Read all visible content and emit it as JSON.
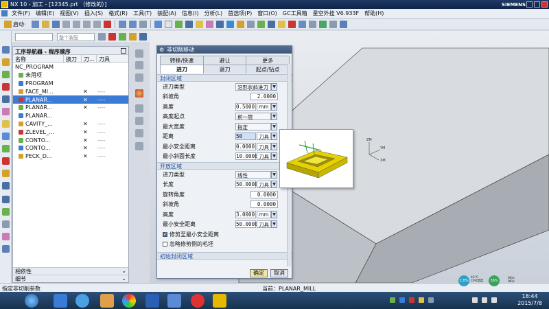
{
  "window": {
    "title": "NX 10 - 加工 - [12345.prt （修改的）]",
    "brand": "SIEMENS"
  },
  "menu": [
    "文件(F)",
    "编辑(E)",
    "视图(V)",
    "插入(S)",
    "格式(R)",
    "工具(T)",
    "装配(A)",
    "信息(I)",
    "分析(L)",
    "首选项(P)",
    "窗口(O)",
    "GC工具箱",
    "星空外挂 V6.933F",
    "帮助(H)"
  ],
  "toolbar": {
    "start_label": "启动·",
    "filter_placeholder": "整个装配"
  },
  "navigator": {
    "title": "工序导航器 - 程序顺序",
    "columns": [
      "名称",
      "换刀",
      "刀...",
      "刀具"
    ],
    "rows": [
      {
        "name": "NC_PROGRAM",
        "indent": 0,
        "x": "",
        "dash": ""
      },
      {
        "name": "未用项",
        "indent": 1,
        "x": "",
        "dash": ""
      },
      {
        "name": "PROGRAM",
        "indent": 1,
        "x": "",
        "dash": ""
      },
      {
        "name": "FACE_MI...",
        "indent": 2,
        "x": "✕",
        "dash": "----"
      },
      {
        "name": "PLANAR...",
        "indent": 2,
        "x": "✕",
        "dash": "----"
      },
      {
        "name": "PLANAR...",
        "indent": 2,
        "x": "✕",
        "dash": "----"
      },
      {
        "name": "PLANAR...",
        "indent": 2,
        "x": "",
        "dash": ""
      },
      {
        "name": "CAVITY_...",
        "indent": 2,
        "x": "✕",
        "dash": "----"
      },
      {
        "name": "ZLEVEL_...",
        "indent": 2,
        "x": "✕",
        "dash": "----"
      },
      {
        "name": "CONTO...",
        "indent": 2,
        "x": "✕",
        "dash": "----"
      },
      {
        "name": "CONTO...",
        "indent": 2,
        "x": "✕",
        "dash": "----"
      },
      {
        "name": "PECK_D...",
        "indent": 2,
        "x": "✕",
        "dash": "----"
      }
    ],
    "bottom": [
      "相依性",
      "细节"
    ]
  },
  "dialog": {
    "title": "非切削移动",
    "tabs_row1": [
      "转移/快速",
      "避让",
      "更多"
    ],
    "tabs_row2": [
      "进刀",
      "退刀",
      "起点/钻点"
    ],
    "closed_section": "封闭区域",
    "closed": {
      "type_label": "进刀类型",
      "type_value": "沿形状斜进刀",
      "ramp_label": "斜坡角",
      "ramp_value": "2.0000",
      "height_label": "高度",
      "height_value": "0.5000",
      "height_unit": "mm",
      "height_start_label": "高度起点",
      "height_start_value": "前一层",
      "max_width_label": "最大宽度",
      "max_width_value": "指定",
      "dist_label": "距离",
      "dist_value": "50",
      "dist_unit": "刀具",
      "min_safe_label": "最小安全距离",
      "min_safe_value": "0.0000",
      "min_safe_unit": "刀具",
      "min_ramp_label": "最小斜面长度",
      "min_ramp_value": "10.0000",
      "min_ramp_unit": "刀具"
    },
    "open_section": "开放区域",
    "open": {
      "type_label": "进刀类型",
      "type_value": "线性",
      "length_label": "长度",
      "length_value": "50.0000",
      "length_unit": "刀具",
      "rot_label": "旋转角度",
      "rot_value": "0.0000",
      "ramp_label": "斜坡角",
      "ramp_value": "0.0000",
      "height_label": "高度",
      "height_value": "3.0000",
      "height_unit": "mm",
      "min_safe_label": "最小安全距离",
      "min_safe_value": "50.0000",
      "min_safe_unit": "刀具",
      "check1_label": "修剪至最小安全距离",
      "check2_label": "忽略修剪侧的毛坯"
    },
    "initial_section": "初始封闭区域",
    "ok_label": "确定",
    "cancel_label": "取消"
  },
  "viewport": {
    "axis_x": "XM",
    "axis_y": "YM",
    "axis_z": "ZM"
  },
  "status": {
    "message": "指定非切削参数",
    "current": "当前：PLANAR_MILL"
  },
  "taskbar": {
    "time": "18:44",
    "date": "2015/7/8",
    "cpu_percent": "2.8%",
    "cpu_temp": "42°C",
    "cpu_temp_label": "CPU温度",
    "mem_percent": "36%",
    "net_up": "0K/s",
    "net_down": "0K/s"
  },
  "colors": {
    "accent": "#3a7bd5",
    "title_bg": "#1f3a66",
    "section_text": "#2355a0"
  }
}
